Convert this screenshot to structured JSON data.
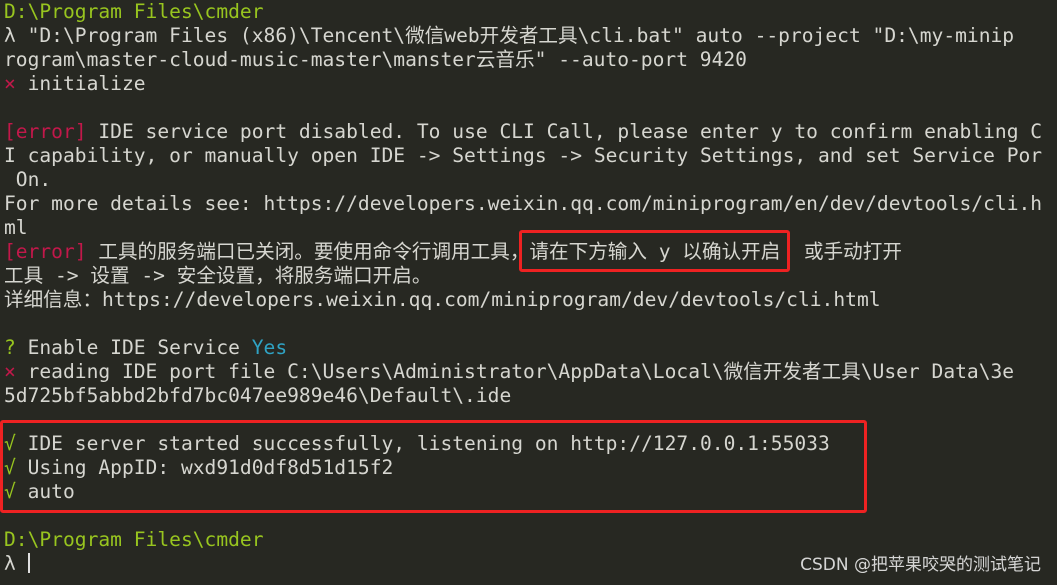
{
  "colors": {
    "background": "#272822",
    "prompt": "#98c51f",
    "error": "#c2184a",
    "answer": "#2fa3c4",
    "highlight_box": "#ee2222"
  },
  "lines": [
    {
      "text": "D:\\Program Files\\cmder"
    },
    {
      "sym": "λ",
      "text": " \"D:\\Program Files (x86)\\Tencent\\微信web开发者工具\\cli.bat\" auto --project \"D:\\my-minip"
    },
    {
      "text": "rogram\\master-cloud-music-master\\manster云音乐\" --auto-port 9420"
    },
    {
      "sym": "×",
      "text": " initialize"
    },
    {
      "text": ""
    },
    {
      "sym": "[error]",
      "text": " IDE service port disabled. To use CLI Call, please enter y to confirm enabling C"
    },
    {
      "text": "I capability, or manually open IDE -> Settings -> Security Settings, and set Service Por"
    },
    {
      "text": " On."
    },
    {
      "text": "For more details see: https://developers.weixin.qq.com/miniprogram/en/dev/devtools/cli.h"
    },
    {
      "text": "ml"
    },
    {
      "sym": "[error]",
      "text": " 工具的服务端口已关闭。要使用命令行调用工具，请在下方输入 y 以确认开启  或手动打开"
    },
    {
      "text": "工具 -> 设置 -> 安全设置，将服务端口开启。"
    },
    {
      "text": "详细信息：https://developers.weixin.qq.com/miniprogram/dev/devtools/cli.html"
    },
    {
      "text": ""
    },
    {
      "sym": "?",
      "text": " Enable IDE Service ",
      "answer": "Yes"
    },
    {
      "sym": "×",
      "text": " reading IDE port file C:\\Users\\Administrator\\AppData\\Local\\微信开发者工具\\User Data\\3e"
    },
    {
      "text": "5d725bf5abbd2bfd7bc047ee989e46\\Default\\.ide"
    },
    {
      "text": ""
    },
    {
      "sym": "√",
      "text": " IDE server started successfully, listening on http://127.0.0.1:55033"
    },
    {
      "sym": "√",
      "text": " Using AppID: wxd91d0df8d51d15f2"
    },
    {
      "sym": "√",
      "text": " auto"
    },
    {
      "text": ""
    },
    {
      "text": "D:\\Program Files\\cmder"
    },
    {
      "sym": "λ",
      "text": " "
    }
  ],
  "watermark": "CSDN @把苹果咬哭的测试笔记"
}
